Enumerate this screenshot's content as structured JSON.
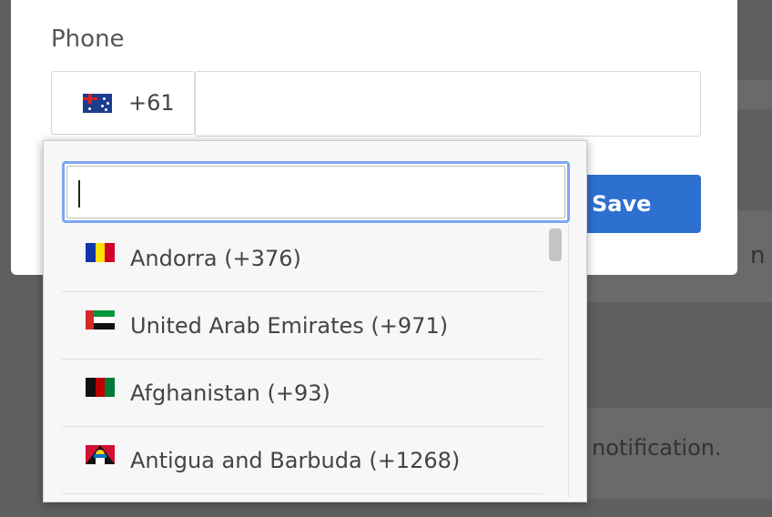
{
  "background": {
    "partial_text_right": "n fr",
    "partial_text_notification": "notification."
  },
  "modal": {
    "phone_label": "Phone",
    "country_code": "+61",
    "selected_country_flag": "australia-flag",
    "phone_value": "",
    "save_label": "Save",
    "accent_color": "#2d70cf"
  },
  "dropdown": {
    "search_value": "",
    "items": [
      {
        "name": "Andorra (+376)",
        "flag": "andorra-flag"
      },
      {
        "name": "United Arab Emirates (+971)",
        "flag": "uae-flag"
      },
      {
        "name": "Afghanistan (+93)",
        "flag": "afghanistan-flag"
      },
      {
        "name": "Antigua and Barbuda (+1268)",
        "flag": "antigua-flag"
      }
    ]
  }
}
